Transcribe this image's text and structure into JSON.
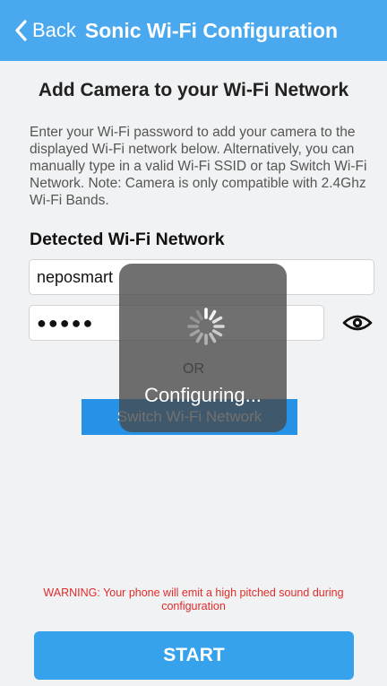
{
  "nav": {
    "back_label": "Back",
    "title": "Sonic Wi-Fi Configuration"
  },
  "main": {
    "heading": "Add Camera to your Wi-Fi Network",
    "description": "Enter your Wi-Fi password to add your camera to the displayed Wi-Fi network below. Alternatively, you can manually type in a valid Wi-Fi SSID or tap Switch Wi-Fi Network. Note: Camera is only compatible with 2.4Ghz Wi-Fi Bands.",
    "section_title": "Detected Wi-Fi Network",
    "ssid_value": "neposmart",
    "password_value": "●●●●●",
    "or_label": "OR",
    "switch_button": "Switch Wi-Fi Network",
    "warning": "WARNING: Your phone will emit a high pitched sound during configuration",
    "start_button": "START"
  },
  "overlay": {
    "label": "Configuring..."
  },
  "icons": {
    "back": "chevron-left-icon",
    "eye": "eye-icon",
    "spinner": "spinner-icon"
  },
  "colors": {
    "nav_bar": "#49a8ee",
    "switch_button": "#2592e6",
    "start_button": "#36a2ec",
    "warning_text": "#e22b2b",
    "background": "#f1f2f3"
  }
}
